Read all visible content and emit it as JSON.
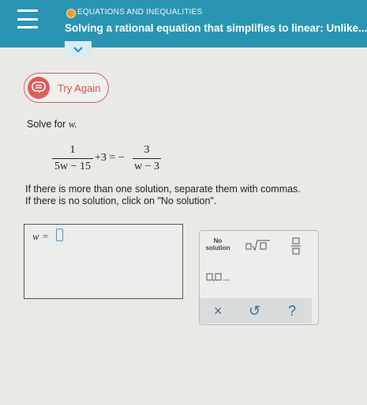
{
  "header": {
    "topic": "EQUATIONS AND INEQUALITIES",
    "title": "Solving a rational equation that simplifies to linear: Unlike..."
  },
  "try_again": {
    "label": "Try Again"
  },
  "problem": {
    "prompt_text": "Solve for ",
    "prompt_var": "w.",
    "eq": {
      "frac1_num": "1",
      "frac1_den": "5w − 15",
      "middle": "+3 = −",
      "frac2_num": "3",
      "frac2_den": "w − 3"
    },
    "instruction1": "If there is more than one solution, separate them with commas.",
    "instruction2": "If there is no solution, click on \"No solution\"."
  },
  "answer": {
    "var_label": "w ="
  },
  "keypad": {
    "no_solution": "No solution",
    "clear": "×",
    "undo": "↺",
    "help": "?"
  },
  "colors": {
    "header": "#2a95b3",
    "status_dot": "#f19a2f",
    "error": "#e25a5a",
    "cursor": "#3b9cd0"
  }
}
